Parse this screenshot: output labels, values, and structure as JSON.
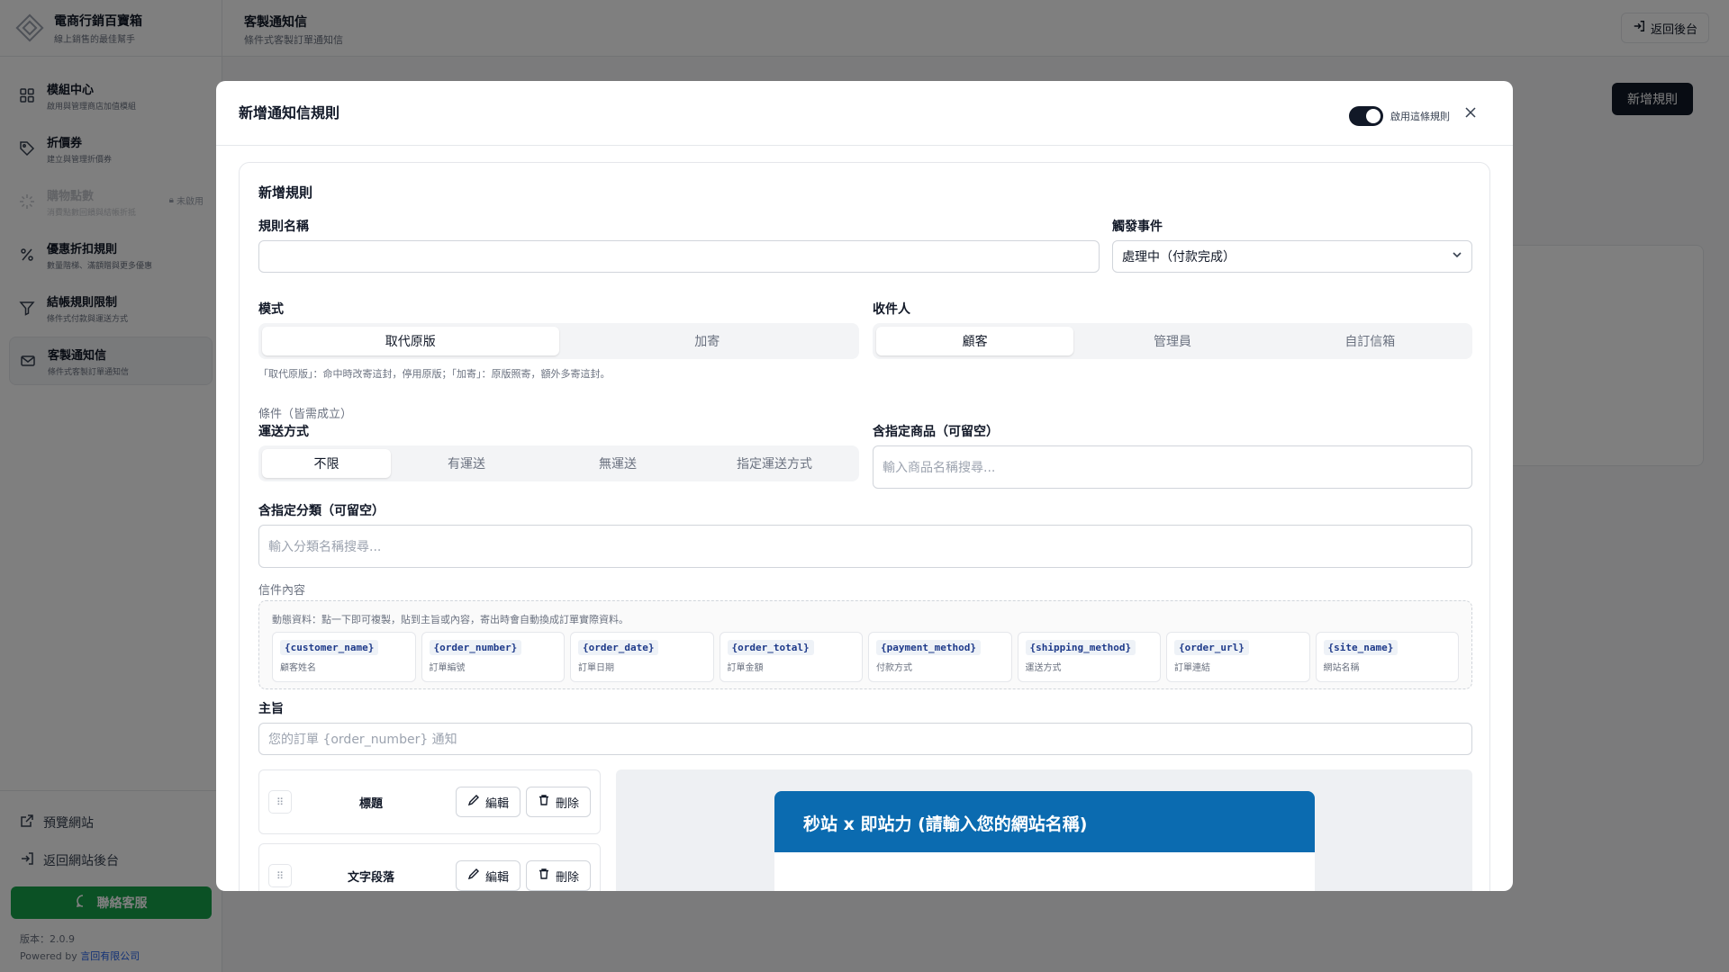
{
  "brand": {
    "title": "電商行銷百寶箱",
    "subtitle": "線上銷售的最佳幫手"
  },
  "sidebar": {
    "items": [
      {
        "label": "模組中心",
        "desc": "啟用與管理商店加值模組",
        "icon": "grid-icon"
      },
      {
        "label": "折價券",
        "desc": "建立與管理折價券",
        "icon": "tag-icon"
      },
      {
        "label": "購物點數",
        "desc": "消費點數回饋與結帳折抵",
        "icon": "sparkle-icon",
        "badge": "未啟用"
      },
      {
        "label": "優惠折扣規則",
        "desc": "數量階梯、滿額贈與更多優惠",
        "icon": "percent-icon"
      },
      {
        "label": "結帳規則限制",
        "desc": "條件式付款與運送方式",
        "icon": "filter-icon"
      },
      {
        "label": "客製通知信",
        "desc": "條件式客製訂單通知信",
        "icon": "mail-icon"
      }
    ],
    "preview_site": "預覽網站",
    "back_site_admin": "返回網站後台",
    "contact": "聯絡客服",
    "version": "版本：2.0.9",
    "powered_prefix": "Powered by",
    "powered_company": "言回有限公司"
  },
  "header": {
    "title": "客製通知信",
    "subtitle": "條件式客製訂單通知信",
    "back_button": "返回後台",
    "new_rule_button": "新增規則"
  },
  "modal": {
    "title": "新增通知信規則",
    "toggle_label": "啟用這條規則",
    "section_title": "新增規則",
    "rule_name_label": "規則名稱",
    "rule_name_value": "",
    "trigger_label": "觸發事件",
    "trigger_value": "處理中（付款完成）",
    "mode_label": "模式",
    "mode_options": [
      "取代原版",
      "加寄"
    ],
    "mode_hint": "「取代原版」：命中時改寄這封，停用原版；「加寄」：原版照寄，額外多寄這封。",
    "recipient_label": "收件人",
    "recipient_options": [
      "顧客",
      "管理員",
      "自訂信箱"
    ],
    "conditions_label": "條件（皆需成立）",
    "shipping_label": "運送方式",
    "shipping_options": [
      "不限",
      "有運送",
      "無運送",
      "指定運送方式"
    ],
    "products_label": "含指定商品（可留空）",
    "products_placeholder": "輸入商品名稱搜尋...",
    "categories_label": "含指定分類（可留空）",
    "categories_placeholder": "輸入分類名稱搜尋...",
    "content_label": "信件內容",
    "vars_hint": "動態資料：點一下即可複製，貼到主旨或內容，寄出時會自動換成訂單實際資料。",
    "variables": [
      {
        "code": "{customer_name}",
        "desc": "顧客姓名"
      },
      {
        "code": "{order_number}",
        "desc": "訂單編號"
      },
      {
        "code": "{order_date}",
        "desc": "訂單日期"
      },
      {
        "code": "{order_total}",
        "desc": "訂單金額"
      },
      {
        "code": "{payment_method}",
        "desc": "付款方式"
      },
      {
        "code": "{shipping_method}",
        "desc": "運送方式"
      },
      {
        "code": "{order_url}",
        "desc": "訂單連結"
      },
      {
        "code": "{site_name}",
        "desc": "網站名稱"
      }
    ],
    "subject_label": "主旨",
    "subject_placeholder": "您的訂單 {order_number} 通知",
    "blocks": [
      {
        "name": "標題",
        "edit": "編輯",
        "delete": "刪除"
      },
      {
        "name": "文字段落",
        "edit": "編輯",
        "delete": "刪除"
      }
    ],
    "preview_heading": "秒站 x 即站力 (請輸入您的網站名稱)"
  }
}
